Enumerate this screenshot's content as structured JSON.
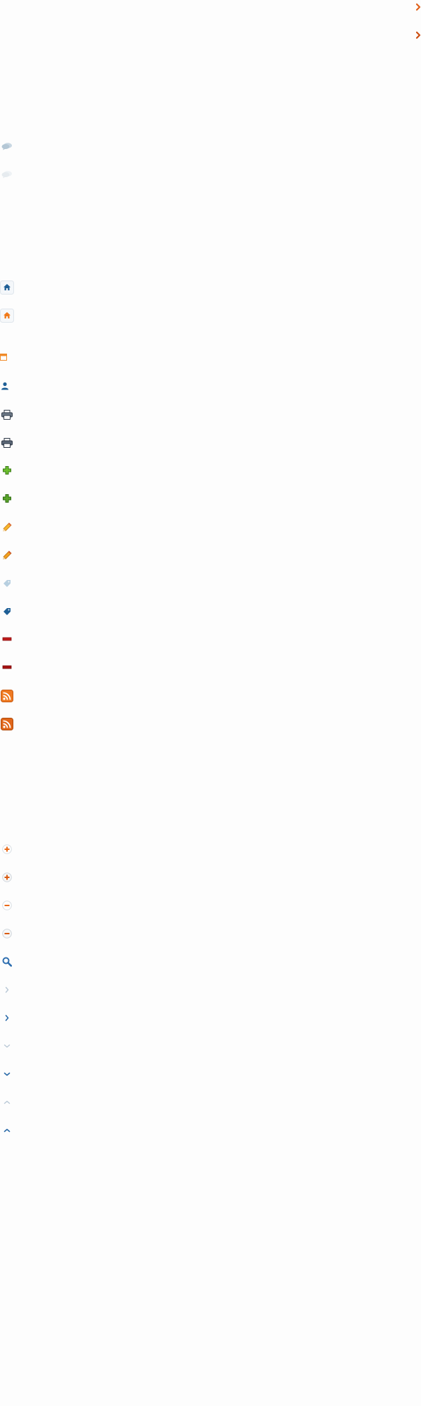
{
  "sprite_sheet": {
    "background_color": "#fdfdfd",
    "icons": [
      {
        "name": "chevron-right-orange-icon",
        "color": "#e0601a"
      },
      {
        "name": "chevron-right-orange-hover-icon",
        "color": "#cc4e10"
      },
      {
        "name": "speech-bubble-icon",
        "color": "#b9cbd8"
      },
      {
        "name": "speech-bubble-faded-icon",
        "color": "#e9eef2"
      },
      {
        "name": "home-blue-icon",
        "color": "#1e5f96"
      },
      {
        "name": "home-orange-icon",
        "color": "#f07a1a"
      },
      {
        "name": "calendar-icon",
        "color": "#f08a28"
      },
      {
        "name": "user-icon",
        "color": "#1e5f96"
      },
      {
        "name": "printer-icon",
        "color": "#2f3a48"
      },
      {
        "name": "printer-hover-icon",
        "color": "#2a3442"
      },
      {
        "name": "plus-green-icon",
        "color": "#5aa62a"
      },
      {
        "name": "plus-green-hover-icon",
        "color": "#4a9320"
      },
      {
        "name": "pencil-icon",
        "color": "#f2a020"
      },
      {
        "name": "pencil-hover-icon",
        "color": "#f2a020"
      },
      {
        "name": "tag-light-icon",
        "color": "#b7cfe0"
      },
      {
        "name": "tag-dark-icon",
        "color": "#1e5f96"
      },
      {
        "name": "minus-red-icon",
        "color": "#b01818"
      },
      {
        "name": "minus-red-hover-icon",
        "color": "#a51212"
      },
      {
        "name": "rss-icon",
        "color": "#ee7a22"
      },
      {
        "name": "rss-hover-icon",
        "color": "#e0661a"
      },
      {
        "name": "zoom-in-circle-icon",
        "color": "#e86a1a"
      },
      {
        "name": "zoom-in-circle-hover-icon",
        "color": "#d95a10"
      },
      {
        "name": "zoom-out-circle-icon",
        "color": "#e86a1a"
      },
      {
        "name": "zoom-out-circle-hover-icon",
        "color": "#d95a10"
      },
      {
        "name": "search-icon",
        "color": "#2f6fb0"
      },
      {
        "name": "chevron-right-light-icon",
        "color": "#b9c8d6"
      },
      {
        "name": "chevron-right-dark-icon",
        "color": "#2a6aa8"
      },
      {
        "name": "chevron-down-light-icon",
        "color": "#b9c8d6"
      },
      {
        "name": "chevron-down-dark-icon",
        "color": "#2a6aa8"
      },
      {
        "name": "chevron-up-light-icon",
        "color": "#b9c8d6"
      },
      {
        "name": "chevron-up-dark-icon",
        "color": "#2a6aa8"
      }
    ]
  }
}
